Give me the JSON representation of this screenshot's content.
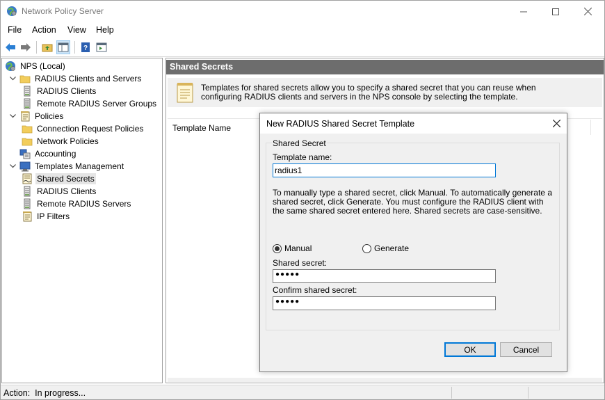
{
  "window": {
    "title": "Network Policy Server"
  },
  "menu": [
    "File",
    "Action",
    "View",
    "Help"
  ],
  "tree": {
    "items": [
      {
        "label": "NPS (Local)",
        "icon": "globe-icon",
        "level": 0,
        "chevron": ""
      },
      {
        "label": "RADIUS Clients and Servers",
        "icon": "folder-icon",
        "level": 1,
        "chevron": "expanded"
      },
      {
        "label": "RADIUS Clients",
        "icon": "server-icon",
        "level": 2,
        "chevron": ""
      },
      {
        "label": "Remote RADIUS Server Groups",
        "icon": "server-icon",
        "level": 2,
        "chevron": ""
      },
      {
        "label": "Policies",
        "icon": "document-icon",
        "level": 1,
        "chevron": "expanded"
      },
      {
        "label": "Connection Request Policies",
        "icon": "folder-icon",
        "level": 2,
        "chevron": ""
      },
      {
        "label": "Network Policies",
        "icon": "folder-icon",
        "level": 2,
        "chevron": ""
      },
      {
        "label": "Accounting",
        "icon": "accounting-icon",
        "level": 1,
        "chevron": ""
      },
      {
        "label": "Templates Management",
        "icon": "monitor-icon",
        "level": 1,
        "chevron": "expanded"
      },
      {
        "label": "Shared Secrets",
        "icon": "certificate-icon",
        "level": 2,
        "chevron": "",
        "selected": true
      },
      {
        "label": "RADIUS Clients",
        "icon": "server-icon",
        "level": 2,
        "chevron": ""
      },
      {
        "label": "Remote RADIUS Servers",
        "icon": "server-icon",
        "level": 2,
        "chevron": ""
      },
      {
        "label": "IP Filters",
        "icon": "document-icon",
        "level": 2,
        "chevron": ""
      }
    ]
  },
  "right_pane": {
    "header": "Shared Secrets",
    "info": "Templates for shared secrets allow you to specify a shared secret that you can reuse when configuring RADIUS clients and servers in the NPS console by selecting the template.",
    "column": "Template Name"
  },
  "dialog": {
    "title": "New RADIUS Shared Secret Template",
    "group": "Shared Secret",
    "template_name_label": "Template name:",
    "template_name_value": "radius1",
    "help": "To manually type a shared secret, click Manual. To automatically generate a shared secret, click Generate. You must configure the RADIUS client with the same shared secret entered here. Shared secrets are case-sensitive.",
    "radio_manual": "Manual",
    "radio_generate": "Generate",
    "selected_radio": "Manual",
    "shared_secret_label": "Shared secret:",
    "shared_secret_mask": "●●●●●",
    "confirm_label": "Confirm shared secret:",
    "confirm_mask": "●●●●●",
    "ok": "OK",
    "cancel": "Cancel"
  },
  "status": {
    "text": "Action:  In progress..."
  }
}
